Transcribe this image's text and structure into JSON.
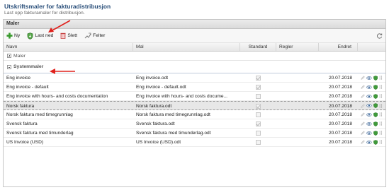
{
  "page": {
    "title": "Utskriftsmaler for fakturadistribusjon",
    "subtitle": "Last opp fakturamaler for distribusjon."
  },
  "panel": {
    "title": "Maler"
  },
  "toolbar": {
    "new_label": "Ny",
    "download_label": "Last ned",
    "delete_label": "Slett",
    "fields_label": "Felter"
  },
  "columns": {
    "name": "Navn",
    "template": "Mal",
    "standard": "Standard",
    "rules": "Regler",
    "changed": "Endret"
  },
  "groups": {
    "maler": "Maler",
    "systemmaler": "Systemmaler"
  },
  "rows": [
    {
      "name": "Eng invoice",
      "template": "Eng invoice.odt",
      "standard": true,
      "rules": "",
      "changed": "20.07.2018"
    },
    {
      "name": "Eng invoice - default",
      "template": "Eng invoice - default.odt",
      "standard": true,
      "rules": "",
      "changed": "20.07.2018"
    },
    {
      "name": "Eng invoice with hours- and costs documentation",
      "template": "Eng invoice with hours- and costs docume...",
      "standard": false,
      "rules": "",
      "changed": "20.07.2018"
    },
    {
      "name": "Norsk faktura",
      "template": "Norsk faktura.odt",
      "standard": true,
      "rules": "",
      "changed": "20.07.2018"
    },
    {
      "name": "Norsk faktura med timegrunnlag",
      "template": "Norsk faktura med timegrunnlag.odt",
      "standard": false,
      "rules": "",
      "changed": "20.07.2018"
    },
    {
      "name": "Svensk faktura",
      "template": "Svensk faktura.odt",
      "standard": true,
      "rules": "",
      "changed": "20.07.2018"
    },
    {
      "name": "Svensk faktura med timunderlag",
      "template": "Svensk faktura med timunderlag.odt",
      "standard": false,
      "rules": "",
      "changed": "20.07.2018"
    },
    {
      "name": "US Invoice (USD)",
      "template": "US Invoice (USD).odt",
      "standard": false,
      "rules": "",
      "changed": "20.07.2018"
    }
  ],
  "selected_row": 3,
  "colors": {
    "title": "#2a4f7a",
    "annotation_arrow": "#e0201b",
    "shield": "#3f9a3a"
  },
  "icons": [
    "add-icon",
    "download-shield-icon",
    "delete-icon",
    "fields-icon",
    "refresh-icon",
    "edit-icon",
    "preview-eye-icon",
    "shield-icon",
    "more-dots-icon"
  ]
}
